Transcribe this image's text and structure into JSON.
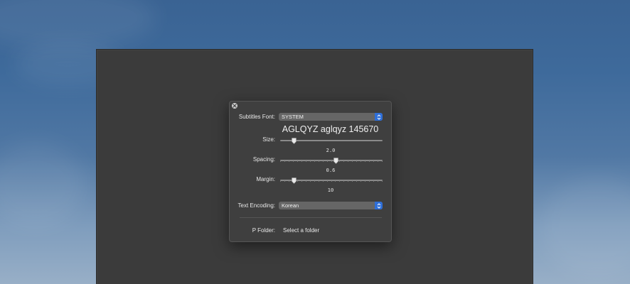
{
  "preferences": {
    "subtitles_font": {
      "label": "Subtitles Font:",
      "value": "SYSTEM"
    },
    "font_preview": "AGLQYZ aglqyz 145670",
    "size": {
      "label": "Size:",
      "value": "2.0",
      "fraction": 0.12
    },
    "spacing": {
      "label": "Spacing:",
      "value": "0.6",
      "fraction": 0.55
    },
    "margin": {
      "label": "Margin:",
      "value": "10",
      "fraction": 0.12
    },
    "text_encoding": {
      "label": "Text Encoding:",
      "value": "Korean"
    },
    "folder": {
      "label": "P Folder:",
      "value": "Select a folder"
    }
  },
  "colors": {
    "accent": "#2f6fd8",
    "panel_background": "#3f3f3f",
    "window_background": "#3b3b3b"
  }
}
